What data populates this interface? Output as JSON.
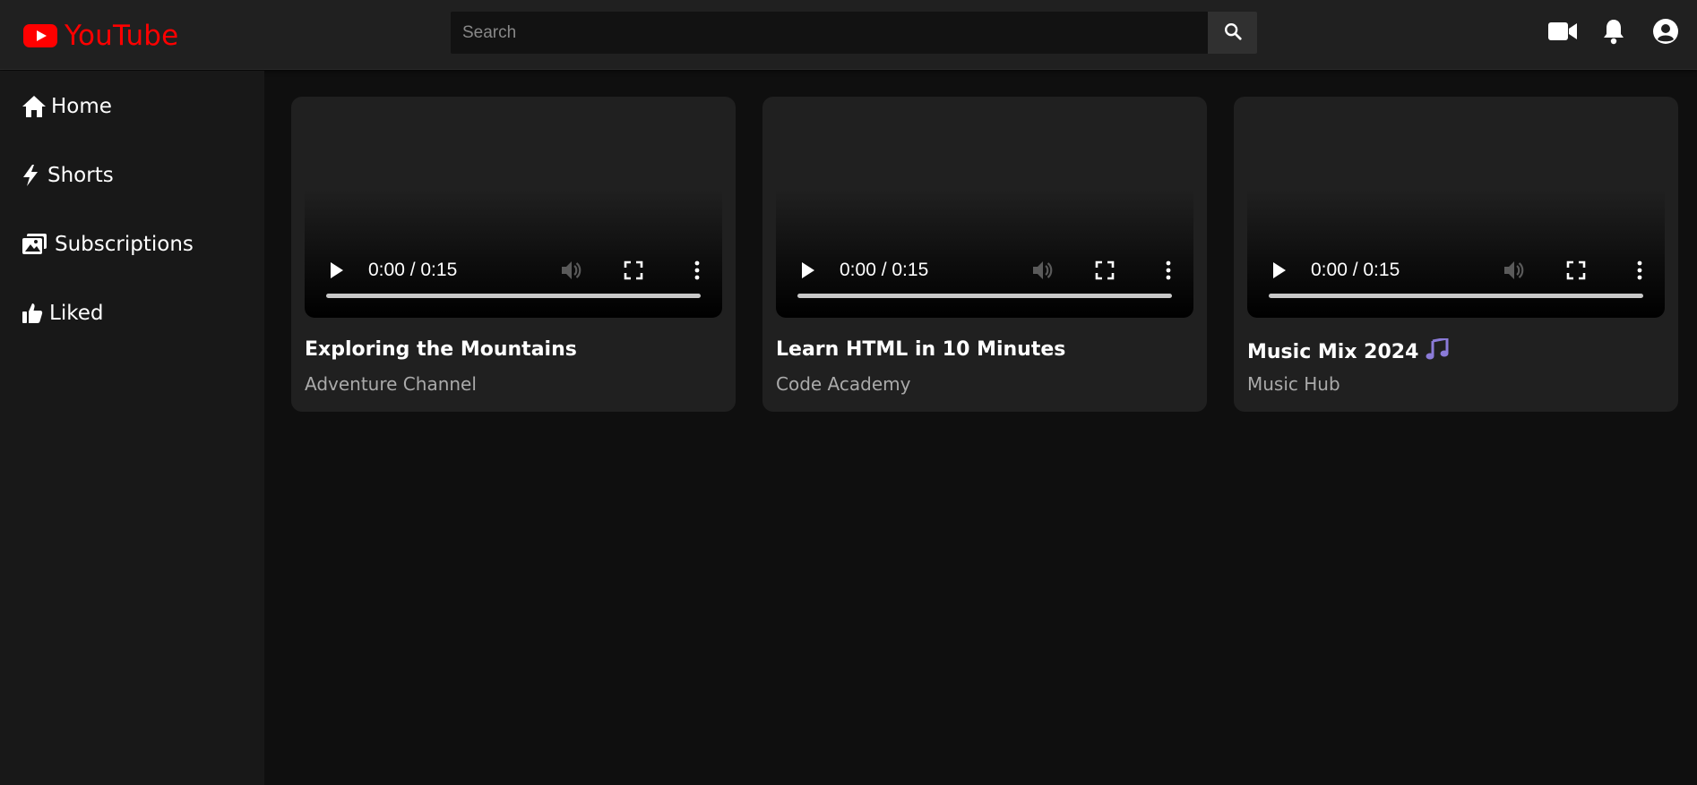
{
  "header": {
    "logo_text": "YouTube",
    "search_placeholder": "Search",
    "search_value": "",
    "icons": [
      "youtube-logo-icon",
      "search-icon",
      "video-camera-icon",
      "bell-icon",
      "account-icon"
    ]
  },
  "sidebar": {
    "items": [
      {
        "label": "Home",
        "icon": "home-icon"
      },
      {
        "label": "Shorts",
        "icon": "bolt-icon"
      },
      {
        "label": "Subscriptions",
        "icon": "subscriptions-icon"
      },
      {
        "label": "Liked",
        "icon": "thumbs-up-icon"
      }
    ]
  },
  "videos": [
    {
      "title": "Exploring the Mountains",
      "channel": "Adventure Channel",
      "time": "0:00 / 0:15",
      "progress": 0
    },
    {
      "title": "Learn HTML in 10 Minutes",
      "channel": "Code Academy",
      "time": "0:00 / 0:15",
      "progress": 0
    },
    {
      "title": "Music Mix 2024",
      "title_emoji": "🎵",
      "channel": "Music Hub",
      "time": "0:00 / 0:15",
      "progress": 0
    }
  ],
  "colors": {
    "brand": "#ff0000",
    "background": "#0f0f0f",
    "header": "#202020",
    "sidebar": "#181818",
    "card": "#202020",
    "secondary_text": "#aaaaaa",
    "emoji_purple": "#8b7bd8"
  }
}
